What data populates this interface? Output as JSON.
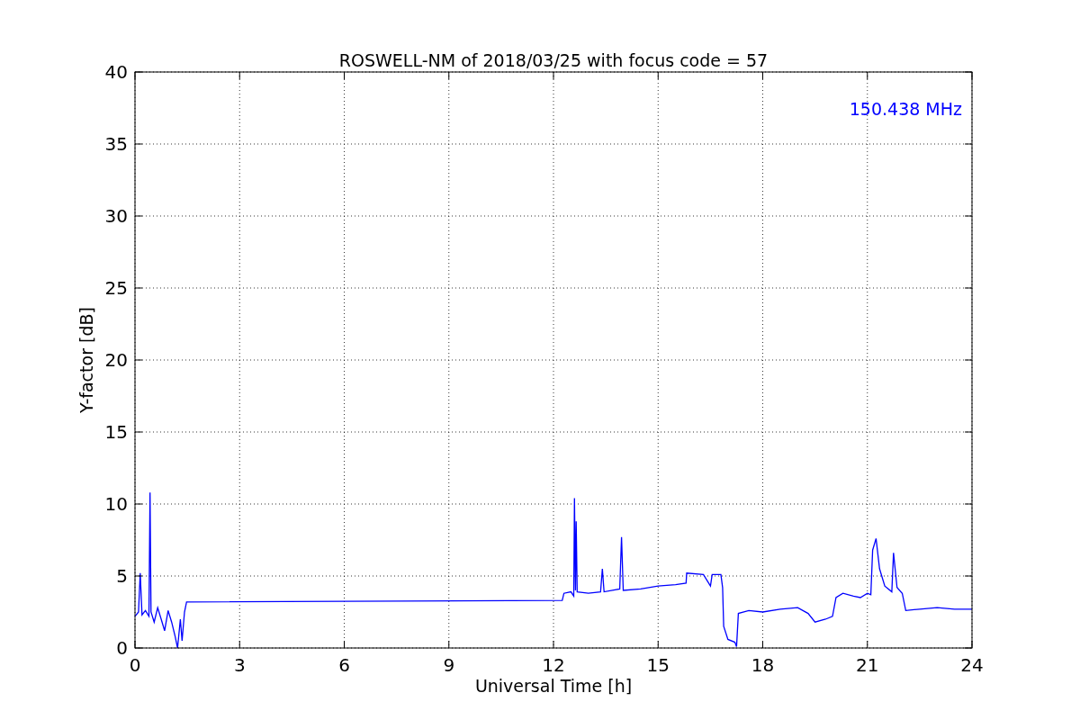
{
  "chart_data": {
    "type": "line",
    "title": "ROSWELL-NM of 2018/03/25 with focus code = 57",
    "xlabel": "Universal Time [h]",
    "ylabel": "Y-factor [dB]",
    "x": [
      0,
      0.1,
      0.15,
      0.2,
      0.3,
      0.4,
      0.43,
      0.46,
      0.55,
      0.65,
      0.75,
      0.85,
      0.95,
      1.05,
      1.15,
      1.22,
      1.3,
      1.35,
      1.42,
      1.48,
      12.25,
      12.3,
      12.5,
      12.58,
      12.6,
      12.63,
      12.65,
      12.68,
      13.0,
      13.35,
      13.4,
      13.45,
      13.9,
      13.95,
      14.0,
      14.5,
      15.0,
      15.5,
      15.8,
      15.82,
      16.3,
      16.5,
      16.55,
      16.8,
      16.85,
      16.88,
      17.0,
      17.2,
      17.25,
      17.3,
      17.6,
      18.0,
      18.5,
      19.0,
      19.3,
      19.5,
      19.8,
      20.0,
      20.1,
      20.3,
      20.6,
      20.8,
      21.0,
      21.1,
      21.15,
      21.25,
      21.35,
      21.5,
      21.7,
      21.75,
      21.85,
      22.0,
      22.1,
      22.5,
      23.0,
      23.5,
      24.0
    ],
    "series": [
      {
        "color": "#0000ff",
        "values": [
          2.2,
          2.5,
          5.2,
          2.3,
          2.6,
          2.2,
          10.8,
          2.5,
          1.8,
          2.8,
          2.0,
          1.2,
          2.6,
          1.8,
          0.8,
          0.0,
          2.0,
          0.5,
          2.5,
          3.2,
          3.3,
          3.8,
          3.9,
          3.6,
          10.4,
          4.0,
          8.8,
          3.9,
          3.8,
          3.9,
          5.5,
          3.9,
          4.1,
          7.7,
          4.0,
          4.1,
          4.3,
          4.4,
          4.5,
          5.2,
          5.1,
          4.3,
          5.1,
          5.1,
          4.2,
          1.5,
          0.6,
          0.4,
          0.1,
          2.4,
          2.6,
          2.5,
          2.7,
          2.8,
          2.4,
          1.8,
          2.0,
          2.2,
          3.5,
          3.8,
          3.6,
          3.5,
          3.8,
          3.7,
          6.8,
          7.6,
          5.5,
          4.3,
          3.9,
          6.6,
          4.2,
          3.8,
          2.6,
          2.7,
          2.8,
          2.7,
          2.7
        ]
      }
    ],
    "xlim": [
      0,
      24
    ],
    "ylim": [
      0,
      40
    ],
    "xticks": [
      0,
      3,
      6,
      9,
      12,
      15,
      18,
      21,
      24
    ],
    "yticks": [
      0,
      5,
      10,
      15,
      20,
      25,
      30,
      35,
      40
    ],
    "grid": true,
    "annotations": [
      {
        "text": "150.438 MHz"
      }
    ]
  }
}
